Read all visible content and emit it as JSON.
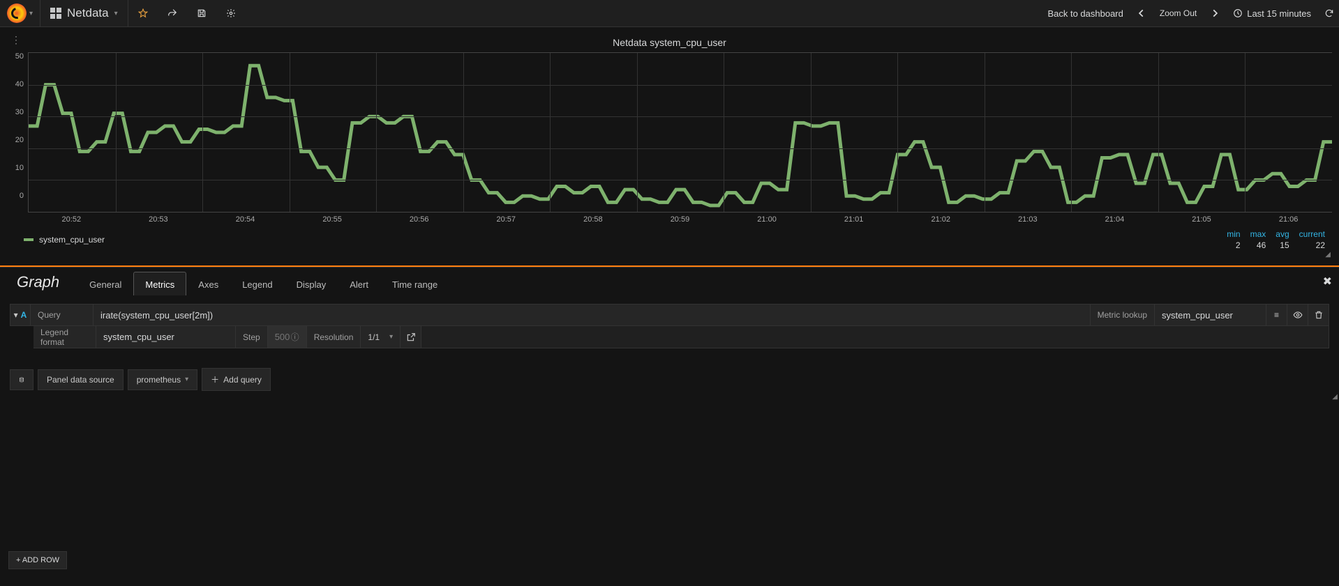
{
  "navbar": {
    "dashboard_name": "Netdata",
    "back_link": "Back to dashboard",
    "zoom_out": "Zoom Out",
    "time_range": "Last 15 minutes",
    "icons": {
      "star": "star-icon",
      "share": "share-icon",
      "save": "save-icon",
      "gear": "gear-icon",
      "chevron_left": "chevron-left",
      "chevron_right": "chevron-right",
      "clock": "clock-icon",
      "refresh": "refresh-icon"
    }
  },
  "panel": {
    "title": "Netdata system_cpu_user",
    "series_name": "system_cpu_user",
    "line_color": "#7eb26d",
    "stats": {
      "min_label": "min",
      "max_label": "max",
      "avg_label": "avg",
      "current_label": "current",
      "min": "2",
      "max": "46",
      "avg": "15",
      "current": "22"
    }
  },
  "chart_data": {
    "type": "line",
    "title": "Netdata system_cpu_user",
    "xlabel": "",
    "ylabel": "",
    "ylim": [
      0,
      50
    ],
    "yticks": [
      0,
      10,
      20,
      30,
      40,
      50
    ],
    "x_tick_labels": [
      "20:52",
      "20:53",
      "20:54",
      "20:55",
      "20:56",
      "20:57",
      "20:58",
      "20:59",
      "21:00",
      "21:01",
      "21:02",
      "21:03",
      "21:04",
      "21:05",
      "21:06"
    ],
    "series": [
      {
        "name": "system_cpu_user",
        "color": "#7eb26d",
        "values": [
          27,
          27,
          40,
          40,
          31,
          31,
          19,
          19,
          22,
          22,
          31,
          31,
          19,
          19,
          25,
          25,
          27,
          27,
          22,
          22,
          26,
          26,
          25,
          25,
          27,
          27,
          46,
          46,
          36,
          36,
          35,
          35,
          19,
          19,
          14,
          14,
          10,
          10,
          28,
          28,
          30,
          30,
          28,
          28,
          30,
          30,
          19,
          19,
          22,
          22,
          18,
          18,
          10,
          10,
          6,
          6,
          3,
          3,
          5,
          5,
          4,
          4,
          8,
          8,
          6,
          6,
          8,
          8,
          3,
          3,
          7,
          7,
          4,
          4,
          3,
          3,
          7,
          7,
          3,
          3,
          2,
          2,
          6,
          6,
          3,
          3,
          9,
          9,
          7,
          7,
          28,
          28,
          27,
          27,
          28,
          28,
          5,
          5,
          4,
          4,
          6,
          6,
          18,
          18,
          22,
          22,
          14,
          14,
          3,
          3,
          5,
          5,
          4,
          4,
          6,
          6,
          16,
          16,
          19,
          19,
          14,
          14,
          3,
          3,
          5,
          5,
          17,
          17,
          18,
          18,
          9,
          9,
          18,
          18,
          9,
          9,
          3,
          3,
          8,
          8,
          18,
          18,
          7,
          7,
          10,
          10,
          12,
          12,
          8,
          8,
          10,
          10,
          22,
          22
        ]
      }
    ]
  },
  "editor": {
    "title": "Graph",
    "tabs": [
      "General",
      "Metrics",
      "Axes",
      "Legend",
      "Display",
      "Alert",
      "Time range"
    ],
    "active_tab": "Metrics"
  },
  "query": {
    "letter": "A",
    "query_label": "Query",
    "query_value": "irate(system_cpu_user[2m])",
    "metric_lookup_label": "Metric lookup",
    "metric_lookup_value": "system_cpu_user",
    "legend_format_label": "Legend format",
    "legend_format_value": "system_cpu_user",
    "step_label": "Step",
    "step_placeholder": "500m",
    "resolution_label": "Resolution",
    "resolution_value": "1/1"
  },
  "panel_ds": {
    "label": "Panel data source",
    "value": "prometheus",
    "add_query": "Add query"
  },
  "add_row": "+ ADD ROW"
}
